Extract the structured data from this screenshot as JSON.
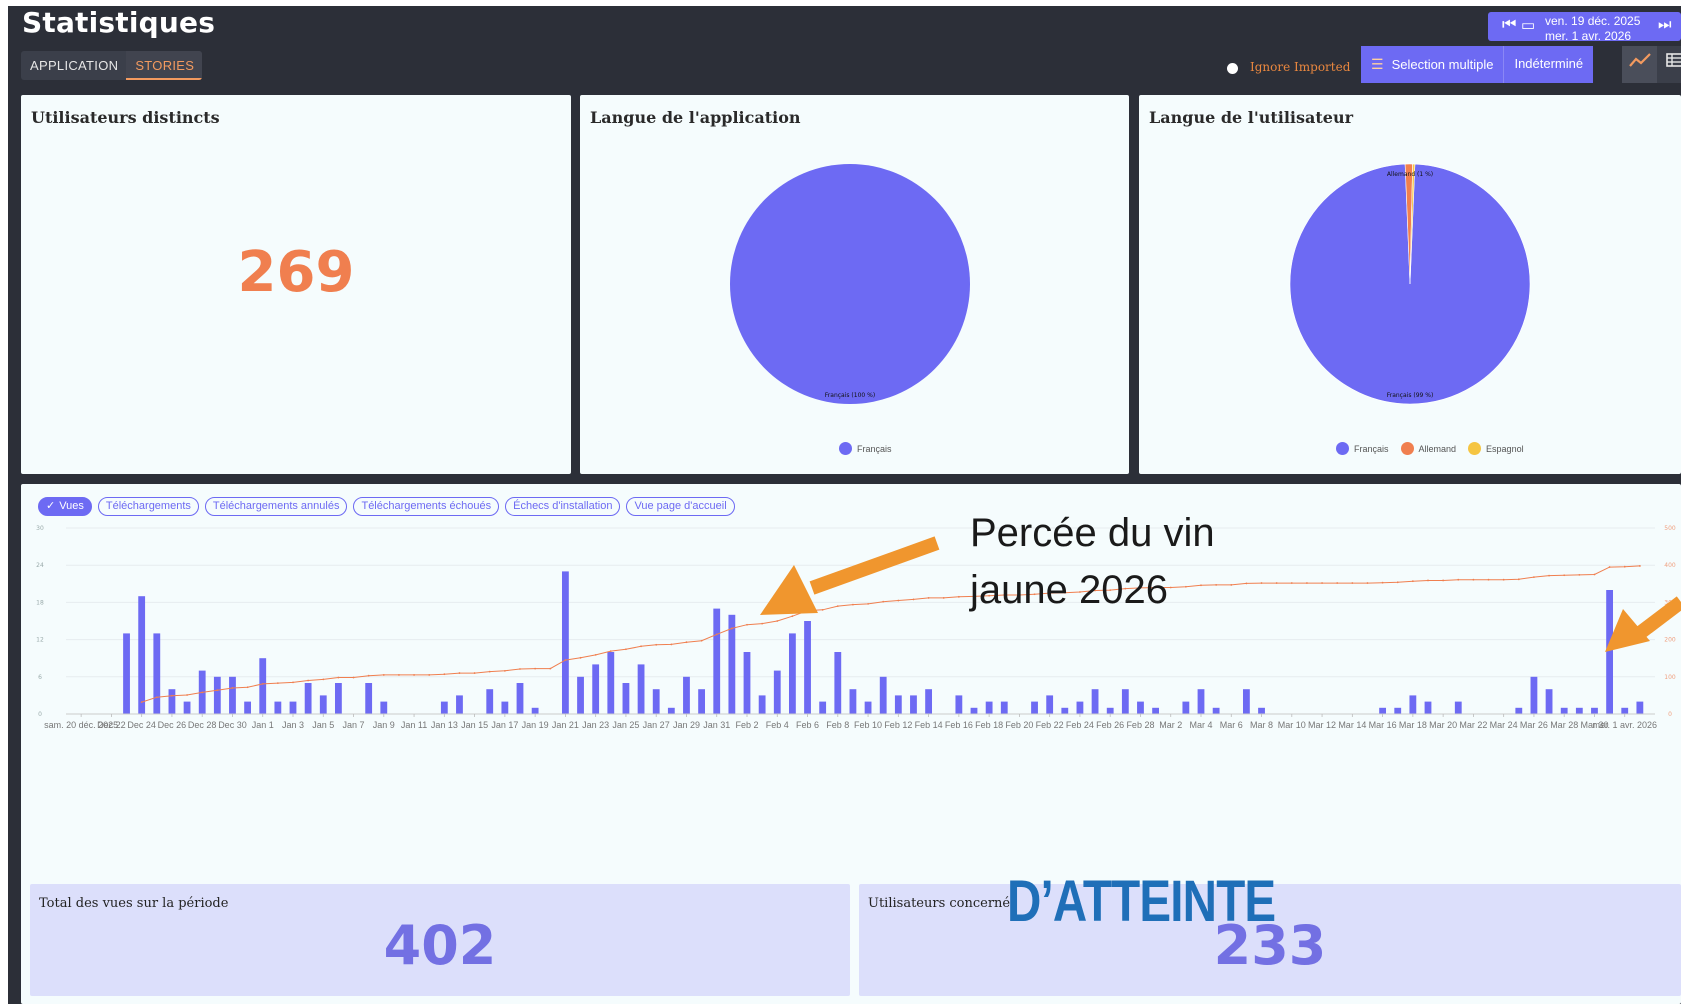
{
  "header": {
    "title": "Statistiques",
    "tabs": [
      {
        "label": "APPLICATION",
        "active": false
      },
      {
        "label": "STORIES",
        "active": true
      }
    ],
    "date_range": {
      "start": "ven. 19 déc. 2025",
      "end": "mer. 1 avr. 2026"
    },
    "ignore_imported_label": "Ignore Imported",
    "selection_button": "Selection multiple",
    "indeterminate_button": "Indéterminé",
    "view_toggles": [
      "chart-icon",
      "table-icon"
    ]
  },
  "cards": {
    "distinct_users": {
      "title": "Utilisateurs distincts",
      "value": "269"
    },
    "app_language": {
      "title": "Langue de l'application",
      "legend": [
        "Français"
      ]
    },
    "user_language": {
      "title": "Langue de l'utilisateur",
      "legend": [
        "Français",
        "Allemand",
        "Espagnol"
      ]
    }
  },
  "filters": {
    "chips": [
      {
        "label": "Vues",
        "selected": true
      },
      {
        "label": "Téléchargements",
        "selected": false
      },
      {
        "label": "Téléchargements annulés",
        "selected": false
      },
      {
        "label": "Téléchargements échoués",
        "selected": false
      },
      {
        "label": "Échecs d'installation",
        "selected": false
      },
      {
        "label": "Vue page d'accueil",
        "selected": false
      }
    ]
  },
  "totals": {
    "views": {
      "title": "Total des vues sur la période",
      "value": "402"
    },
    "users": {
      "title": "Utilisateurs concernés",
      "value": "233"
    }
  },
  "annotation": {
    "line1": "Percée du vin",
    "line2": "jaune 2026",
    "overlay": "D’ATTEINTE"
  },
  "colors": {
    "accent": "#6d6af3",
    "orange": "#f07f4f",
    "yellow": "#f5c542",
    "arrow": "#f0962e"
  },
  "chart_data": [
    {
      "type": "pie",
      "title": "Langue de l'application",
      "slices": [
        {
          "label": "Français",
          "value": 100
        }
      ],
      "slice_labels": [
        "Français (100 %)"
      ],
      "colors": [
        "#6d6af3"
      ]
    },
    {
      "type": "pie",
      "title": "Langue de l'utilisateur",
      "slices": [
        {
          "label": "Français",
          "value": 99
        },
        {
          "label": "Allemand",
          "value": 1
        },
        {
          "label": "Espagnol",
          "value": 0.3
        }
      ],
      "slice_labels": [
        "Français (99 %)",
        "Allemand (1 %)"
      ],
      "colors": [
        "#6d6af3",
        "#f07f4f",
        "#f5c542"
      ]
    },
    {
      "type": "bar",
      "series": [
        {
          "name": "Vues",
          "type": "bar",
          "color": "#6d6af3",
          "values": [
            0,
            0,
            0,
            13,
            19,
            13,
            4,
            2,
            7,
            6,
            6,
            2,
            9,
            2,
            2,
            5,
            3,
            5,
            0,
            5,
            2,
            0,
            0,
            0,
            2,
            3,
            0,
            4,
            2,
            5,
            1,
            0,
            23,
            6,
            8,
            10,
            5,
            8,
            4,
            1,
            6,
            4,
            17,
            16,
            10,
            3,
            7,
            13,
            15,
            2,
            10,
            4,
            2,
            6,
            3,
            3,
            4,
            0,
            3,
            1,
            2,
            2,
            0,
            2,
            3,
            1,
            2,
            4,
            1,
            4,
            2,
            1,
            0,
            2,
            4,
            1,
            0,
            4,
            1,
            0,
            0,
            0,
            0,
            0,
            0,
            0,
            1,
            1,
            3,
            2,
            0,
            2,
            0,
            0,
            0,
            1,
            6,
            4,
            1,
            1,
            1,
            20,
            1,
            2
          ]
        },
        {
          "name": "Cumul",
          "type": "line",
          "color": "#f07f4f",
          "axis": "right",
          "values": [
            0,
            0,
            0,
            13,
            32,
            45,
            49,
            51,
            58,
            64,
            70,
            72,
            81,
            83,
            85,
            90,
            93,
            98,
            98,
            103,
            105,
            105,
            105,
            105,
            107,
            110,
            110,
            114,
            116,
            121,
            122,
            122,
            145,
            151,
            159,
            169,
            174,
            182,
            186,
            187,
            193,
            197,
            214,
            230,
            240,
            243,
            250,
            263,
            278,
            280,
            290,
            294,
            296,
            302,
            305,
            308,
            312,
            312,
            315,
            316,
            318,
            320,
            320,
            322,
            325,
            326,
            328,
            332,
            333,
            337,
            339,
            340,
            340,
            342,
            346,
            347,
            347,
            351,
            352,
            352,
            352,
            352,
            352,
            352,
            352,
            352,
            353,
            354,
            357,
            359,
            359,
            361,
            361,
            361,
            361,
            362,
            368,
            372,
            373,
            374,
            375,
            395,
            396,
            398
          ]
        }
      ],
      "tick_labels": [
        "sam. 20 déc. 2025",
        "Dec 22",
        "Dec 24",
        "Dec 26",
        "Dec 28",
        "Dec 30",
        "Jan 1",
        "Jan 3",
        "Jan 5",
        "Jan 7",
        "Jan 9",
        "Jan 11",
        "Jan 13",
        "Jan 15",
        "Jan 17",
        "Jan 19",
        "Jan 21",
        "Jan 23",
        "Jan 25",
        "Jan 27",
        "Jan 29",
        "Jan 31",
        "Feb 2",
        "Feb 4",
        "Feb 6",
        "Feb 8",
        "Feb 10",
        "Feb 12",
        "Feb 14",
        "Feb 16",
        "Feb 18",
        "Feb 20",
        "Feb 22",
        "Feb 24",
        "Feb 26",
        "Feb 28",
        "Mar 2",
        "Mar 4",
        "Mar 6",
        "Mar 8",
        "Mar 10",
        "Mar 12",
        "Mar 14",
        "Mar 16",
        "Mar 18",
        "Mar 20",
        "Mar 22",
        "Mar 24",
        "Mar 26",
        "Mar 28",
        "Mar 30",
        "mer. 1 avr. 2026"
      ],
      "ylim_left": [
        0,
        30
      ],
      "yticks_left": [
        0,
        6,
        12,
        18,
        24,
        30
      ],
      "ylim_right": [
        0,
        500
      ],
      "yticks_right": [
        0,
        100,
        200,
        300,
        400,
        500
      ],
      "grid": true
    }
  ]
}
